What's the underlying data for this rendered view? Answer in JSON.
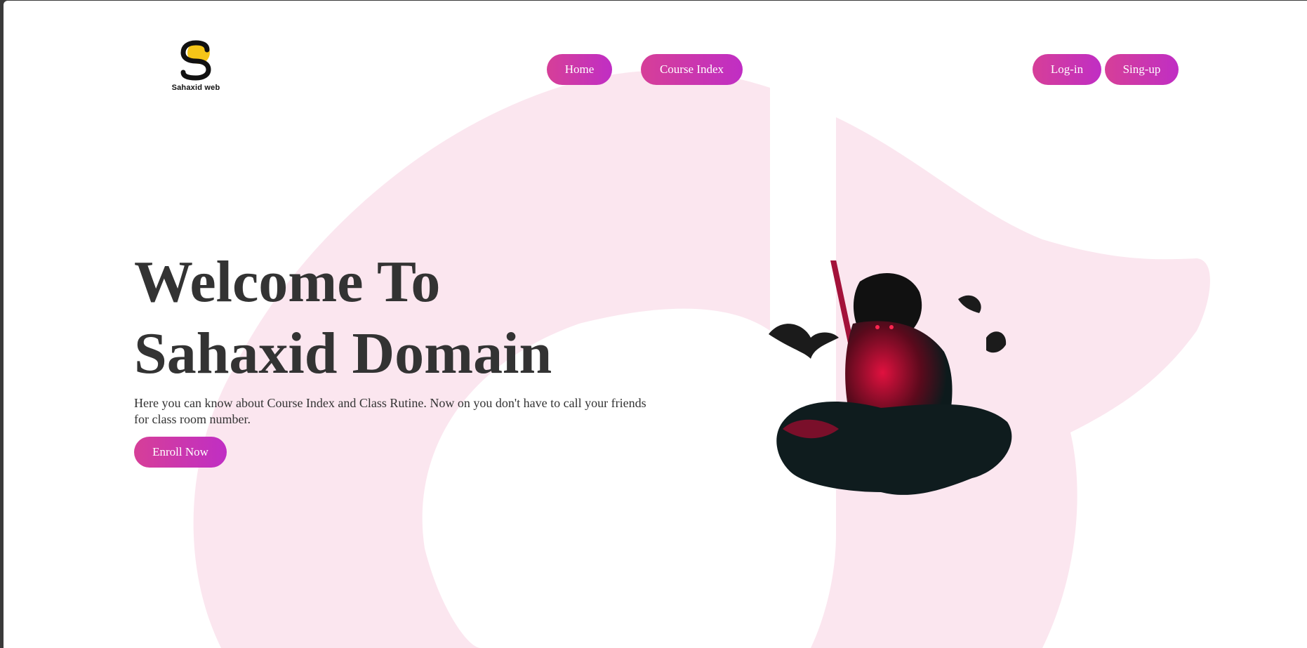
{
  "brand": {
    "name": "Sahaxid web"
  },
  "nav": {
    "home": "Home",
    "course_index": "Course Index"
  },
  "auth": {
    "login": "Log-in",
    "signup": "Sing-up"
  },
  "hero": {
    "title_line1": "Welcome To",
    "title_line2": "Sahaxid Domain",
    "description": "Here you can know about Course Index and Class Rutine. Now on you don't have to call your friends for class room number.",
    "cta": "Enroll Now"
  },
  "colors": {
    "accent_start": "#d63f98",
    "accent_end": "#c02ec4",
    "background_shape": "#fbe6ef",
    "text": "#333333",
    "logo_yellow": "#f5c518"
  },
  "icons": {
    "logo": "sahaxid-logo-icon",
    "hero_image": "ninja-illustration"
  }
}
